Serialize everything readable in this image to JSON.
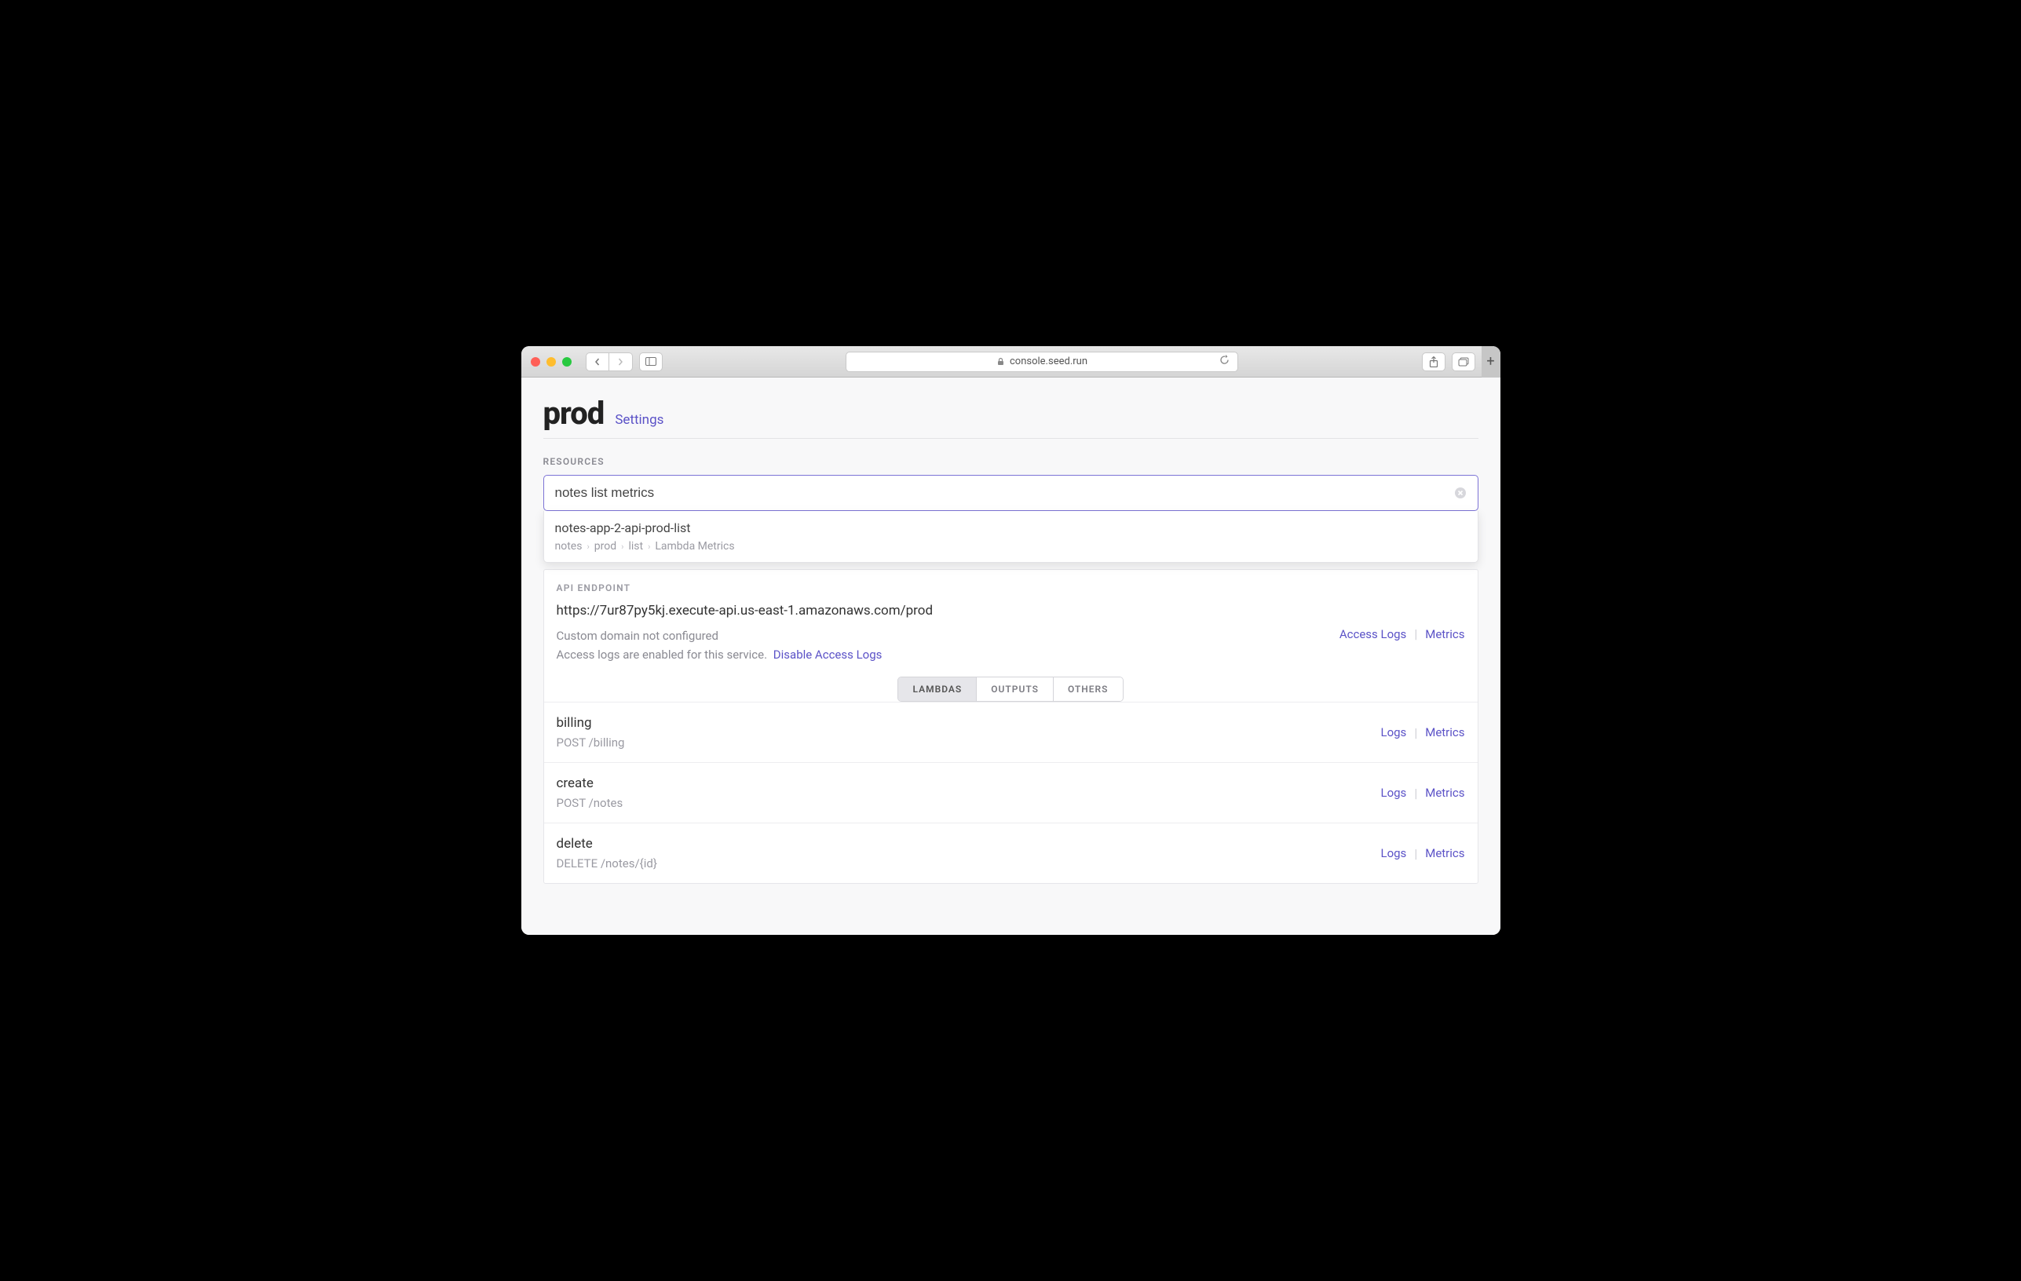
{
  "browser": {
    "url": "console.seed.run"
  },
  "header": {
    "title": "prod",
    "settings_link": "Settings"
  },
  "resources": {
    "section_label": "RESOURCES",
    "search_value": "notes list metrics",
    "dropdown": {
      "title": "notes-app-2-api-prod-list",
      "crumbs": [
        "notes",
        "prod",
        "list",
        "Lambda Metrics"
      ]
    }
  },
  "api": {
    "section_label": "API ENDPOINT",
    "url": "https://7ur87py5kj.execute-api.us-east-1.amazonaws.com/prod",
    "custom_domain_msg": "Custom domain not configured",
    "access_logs_msg": "Access logs are enabled for this service.",
    "disable_link": "Disable Access Logs",
    "access_logs_link": "Access Logs",
    "metrics_link": "Metrics"
  },
  "tabs": {
    "lambdas": "LAMBDAS",
    "outputs": "OUTPUTS",
    "others": "OTHERS"
  },
  "lambdas": [
    {
      "name": "billing",
      "route": "POST /billing"
    },
    {
      "name": "create",
      "route": "POST /notes"
    },
    {
      "name": "delete",
      "route": "DELETE /notes/{id}"
    }
  ],
  "lambda_links": {
    "logs": "Logs",
    "metrics": "Metrics"
  }
}
